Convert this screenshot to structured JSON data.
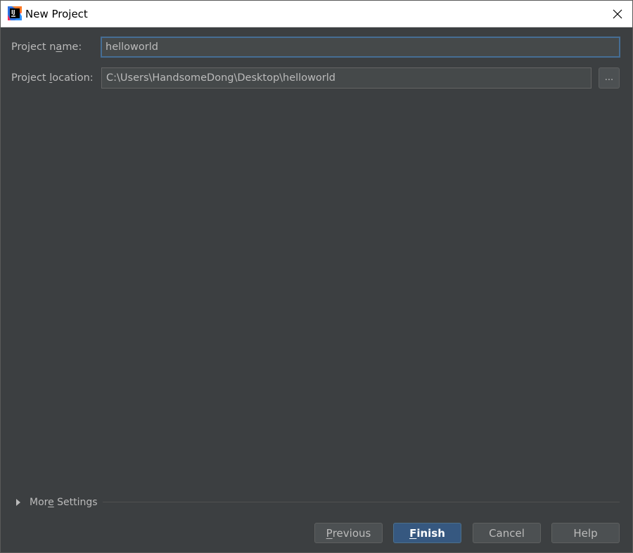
{
  "window": {
    "title": "New Project",
    "icon": "intellij-idea-icon"
  },
  "form": {
    "project_name": {
      "label_before": "Project n",
      "label_mnemonic": "a",
      "label_after": "me:",
      "value": "helloworld"
    },
    "project_location": {
      "label_before": "Project ",
      "label_mnemonic": "l",
      "label_after": "ocation:",
      "value": "C:\\Users\\HandsomeDong\\Desktop\\helloworld",
      "browse_label": "..."
    }
  },
  "more_settings": {
    "label_before": "Mor",
    "label_mnemonic": "e",
    "label_after": " Settings",
    "expanded": false
  },
  "buttons": {
    "previous": {
      "mnemonic": "P",
      "rest": "revious"
    },
    "finish": {
      "mnemonic": "F",
      "rest": "inish"
    },
    "cancel": {
      "label": "Cancel"
    },
    "help": {
      "label": "Help"
    }
  },
  "colors": {
    "background": "#3c3f41",
    "field_background": "#45494a",
    "focus_border": "#466d94",
    "primary_button": "#365880",
    "text": "#bbbbbb"
  }
}
